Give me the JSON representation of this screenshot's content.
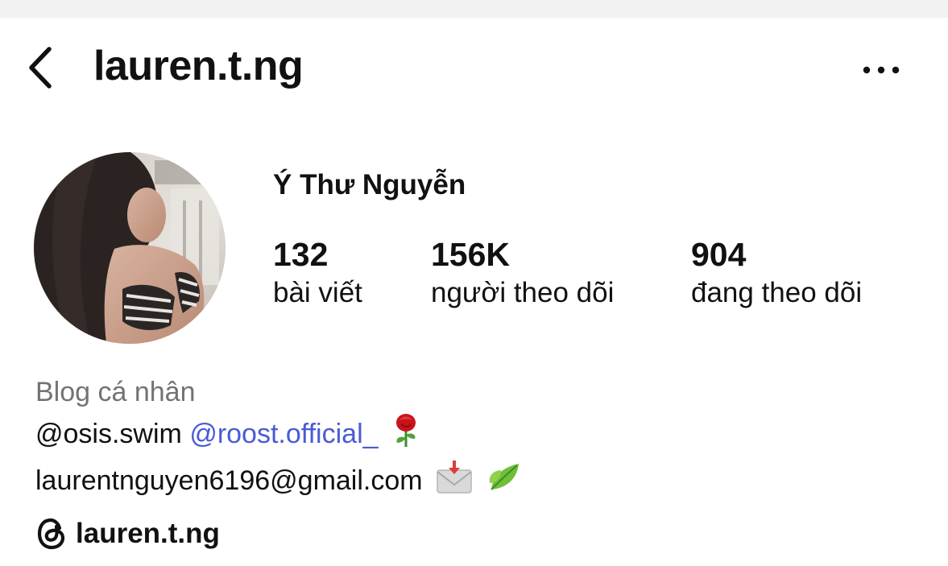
{
  "header": {
    "username": "lauren.t.ng",
    "back_icon": "chevron-left-icon",
    "more_icon": "more-horizontal-icon"
  },
  "profile": {
    "display_name": "Ý Thư Nguyễn",
    "stats": [
      {
        "value": "132",
        "label": "bài viết"
      },
      {
        "value": "156K",
        "label": "người theo dõi"
      },
      {
        "value": "904",
        "label": "đang theo dõi"
      }
    ]
  },
  "bio": {
    "category": "Blog cá nhân",
    "line1_text": "@osis.swim",
    "line1_link": "@roost.official_",
    "line1_emoji": "rose-emoji",
    "line2_text": "laurentnguyen6196@gmail.com",
    "line2_emojis": [
      "incoming-envelope-emoji",
      "leaves-emoji"
    ]
  },
  "threads": {
    "icon": "threads-icon",
    "handle": "lauren.t.ng"
  },
  "colors": {
    "text": "#111111",
    "secondary": "#737373",
    "link": "#4a5bd4",
    "background": "#ffffff",
    "top_strip": "#f2f2f2"
  }
}
